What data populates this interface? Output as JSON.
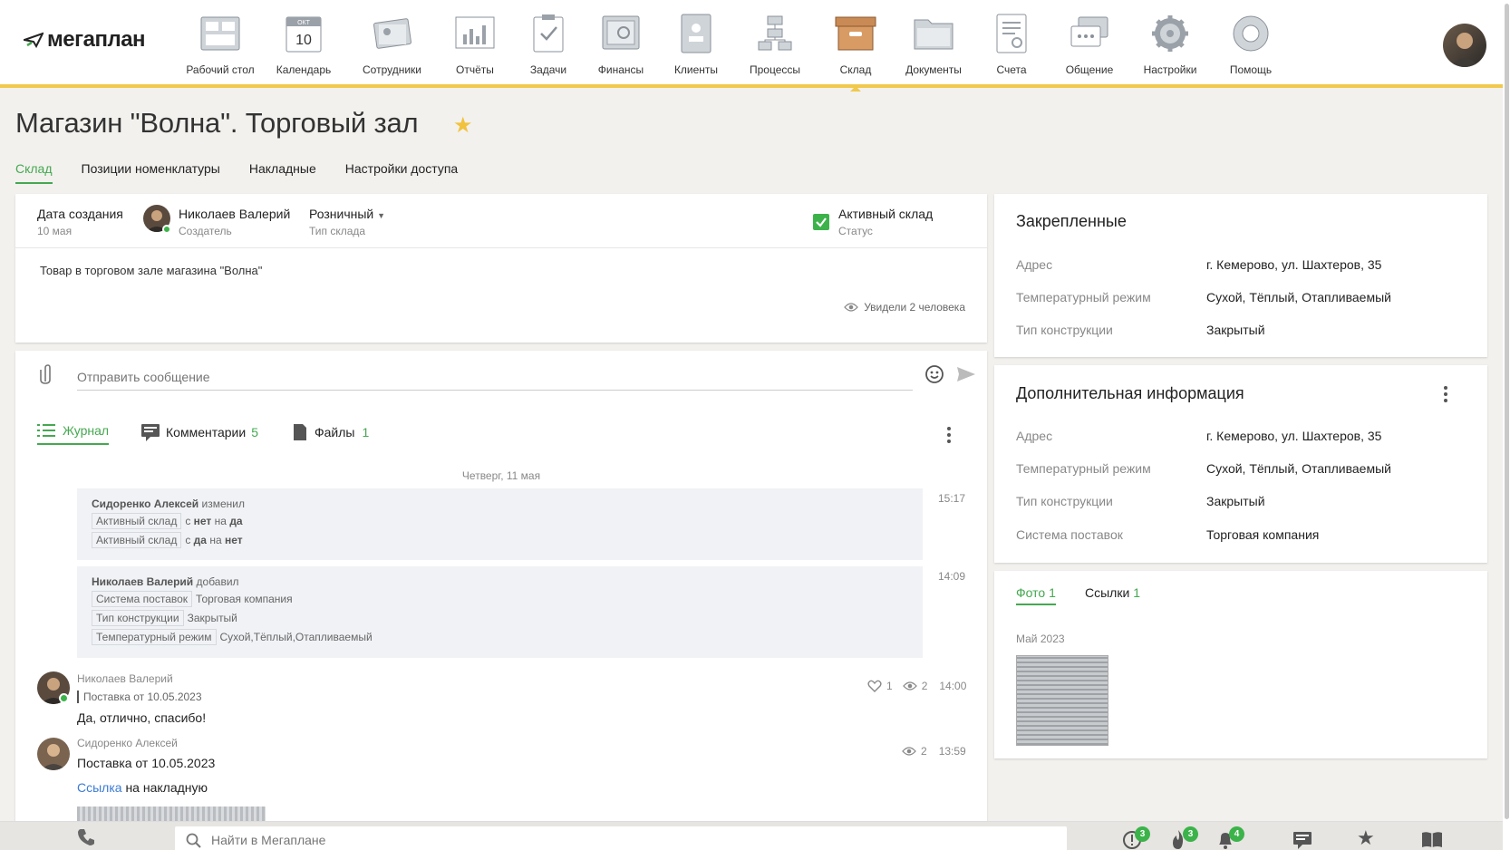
{
  "app": {
    "logo_text": "мегаплан"
  },
  "nav": [
    {
      "label": "Рабочий стол",
      "icon": "desktop-icon"
    },
    {
      "label": "Календарь",
      "icon": "calendar-icon",
      "calendar_month": "ОКТ",
      "calendar_day": "10"
    },
    {
      "label": "Сотрудники",
      "icon": "employees-icon"
    },
    {
      "label": "Отчёты",
      "icon": "reports-icon"
    },
    {
      "label": "Задачи",
      "icon": "tasks-icon"
    },
    {
      "label": "Финансы",
      "icon": "finance-safe-icon"
    },
    {
      "label": "Клиенты",
      "icon": "clients-icon"
    },
    {
      "label": "Процессы",
      "icon": "processes-icon"
    },
    {
      "label": "Склад",
      "icon": "warehouse-box-icon",
      "active": true
    },
    {
      "label": "Документы",
      "icon": "documents-folder-icon"
    },
    {
      "label": "Счета",
      "icon": "invoices-icon"
    },
    {
      "label": "Общение",
      "icon": "chat-icon"
    },
    {
      "label": "Настройки",
      "icon": "settings-gear-icon"
    },
    {
      "label": "Помощь",
      "icon": "help-lifebuoy-icon"
    }
  ],
  "page": {
    "title": "Магазин \"Волна\". Торговый зал"
  },
  "tabs": [
    "Склад",
    "Позиции номенклатуры",
    "Накладные",
    "Настройки доступа"
  ],
  "info": {
    "created_label": "Дата создания",
    "created_value": "10 мая",
    "creator_name": "Николаев Валерий",
    "creator_role": "Создатель",
    "type_value": "Розничный",
    "type_label": "Тип склада",
    "status_value": "Активный склад",
    "status_label": "Статус",
    "description": "Товар в торговом зале магазина \"Волна\"",
    "seen": "Увидели 2 человека"
  },
  "composer": {
    "placeholder": "Отправить сообщение"
  },
  "feed_tabs": {
    "journal": "Журнал",
    "comments": "Комментарии",
    "comments_count": "5",
    "files": "Файлы",
    "files_count": "1"
  },
  "feed": {
    "date": "Четверг, 11 мая",
    "change1": {
      "author": "Сидоренко Алексей",
      "action": "изменил",
      "time": "15:17",
      "lines": [
        {
          "field": "Активный склад",
          "from_word": "с",
          "from": "нет",
          "to_word": "на",
          "to": "да"
        },
        {
          "field": "Активный склад",
          "from_word": "с",
          "from": "да",
          "to_word": "на",
          "to": "нет"
        }
      ]
    },
    "change2": {
      "author": "Николаев Валерий",
      "action": "добавил",
      "time": "14:09",
      "lines": [
        {
          "field": "Система поставок",
          "value": "Торговая компания"
        },
        {
          "field": "Тип конструкции",
          "value": "Закрытый"
        },
        {
          "field": "Температурный режим",
          "value": "Сухой,Тёплый,Отапливаемый"
        }
      ]
    },
    "comment1": {
      "author": "Николаев Валерий",
      "quote": "Поставка от 10.05.2023",
      "text": "Да, отлично, спасибо!",
      "likes": "1",
      "views": "2",
      "time": "14:00"
    },
    "comment2": {
      "author": "Сидоренко Алексей",
      "text": "Поставка от 10.05.2023",
      "link": "Ссылка",
      "link_tail": "на накладную",
      "views": "2",
      "time": "13:59"
    }
  },
  "pinned": {
    "title": "Закрепленные",
    "rows": [
      {
        "k": "Адрес",
        "v": "г. Кемерово, ул. Шахтеров, 35"
      },
      {
        "k": "Температурный режим",
        "v": "Сухой, Тёплый, Отапливаемый"
      },
      {
        "k": "Тип конструкции",
        "v": "Закрытый"
      }
    ]
  },
  "extra": {
    "title": "Дополнительная информация",
    "rows": [
      {
        "k": "Адрес",
        "v": "г. Кемерово, ул. Шахтеров, 35"
      },
      {
        "k": "Температурный режим",
        "v": "Сухой, Тёплый, Отапливаемый"
      },
      {
        "k": "Тип конструкции",
        "v": "Закрытый"
      },
      {
        "k": "Система поставок",
        "v": "Торговая компания"
      }
    ]
  },
  "media": {
    "photo_tab": "Фото",
    "photo_count": "1",
    "links_tab": "Ссылки",
    "links_count": "1",
    "month": "Май 2023"
  },
  "bottom": {
    "search_placeholder": "Найти в Мегаплане",
    "badge_alerts": "3",
    "badge_fire": "3",
    "badge_bell": "4"
  },
  "colors": {
    "accent_green": "#45a850",
    "nav_underline": "#f0c94d",
    "star": "#f2c23c",
    "link": "#3b7bd4"
  }
}
